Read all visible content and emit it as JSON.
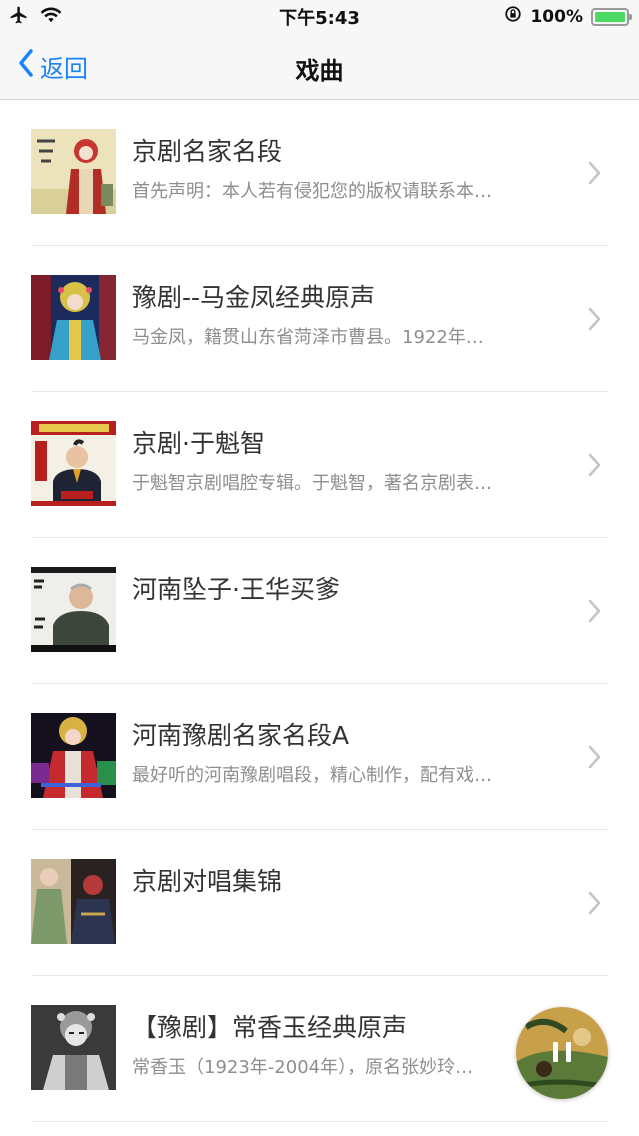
{
  "status_bar": {
    "time": "下午5:43",
    "battery": "100%",
    "battery_level": 1.0,
    "icons": [
      "airplane-icon",
      "wifi-icon",
      "rotation-lock-icon",
      "battery-icon"
    ]
  },
  "nav": {
    "back_label": "返回",
    "title": "戏曲"
  },
  "items": [
    {
      "title": "京剧名家名段",
      "desc": "首先声明：本人若有侵犯您的版权请联系本…"
    },
    {
      "title": "豫剧--马金凤经典原声",
      "desc": " 马金凤，籍贯山东省菏泽市曹县。1922年…"
    },
    {
      "title": "京剧·于魁智",
      "desc": "于魁智京剧唱腔专辑。于魁智，著名京剧表…"
    },
    {
      "title": "河南坠子·王华买爹",
      "desc": ""
    },
    {
      "title": "河南豫剧名家名段A",
      "desc": "最好听的河南豫剧唱段，精心制作，配有戏…"
    },
    {
      "title": "京剧对唱集锦",
      "desc": ""
    },
    {
      "title": "【豫剧】常香玉经典原声",
      "desc": "常香玉（1923年-2004年），原名张妙玲…"
    }
  ],
  "colors": {
    "accent": "#1a82fb",
    "battery": "#4cd964",
    "title_text": "#333333",
    "desc_text": "#8e8e8e"
  }
}
